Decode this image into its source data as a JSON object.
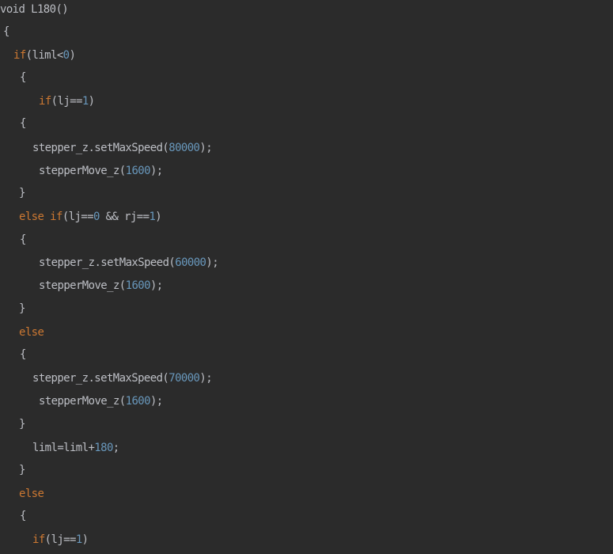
{
  "editor": {
    "colors": {
      "background": "#2b2b2b",
      "plain": "#bcbec4",
      "keyword": "#cc7832",
      "number": "#6897bb"
    },
    "lines": [
      {
        "tokens": [
          {
            "t": "void L180()",
            "c": "pl"
          }
        ]
      },
      {
        "tokens": [
          {
            "t": "{",
            "c": "pl"
          }
        ]
      },
      {
        "tokens": [
          {
            "t": "if",
            "c": "kw"
          },
          {
            "t": "(liml<",
            "c": "pl"
          },
          {
            "t": "0",
            "c": "num"
          },
          {
            "t": ")",
            "c": "pl"
          }
        ]
      },
      {
        "tokens": [
          {
            "t": "{",
            "c": "pl"
          }
        ]
      },
      {
        "tokens": [
          {
            "t": "if",
            "c": "kw"
          },
          {
            "t": "(lj==",
            "c": "pl"
          },
          {
            "t": "1",
            "c": "num"
          },
          {
            "t": ")",
            "c": "pl"
          }
        ]
      },
      {
        "tokens": [
          {
            "t": "{",
            "c": "pl"
          }
        ]
      },
      {
        "tokens": [
          {
            "t": "stepper_z.setMaxSpeed(",
            "c": "pl"
          },
          {
            "t": "80000",
            "c": "num"
          },
          {
            "t": ");",
            "c": "pl"
          }
        ]
      },
      {
        "tokens": [
          {
            "t": "stepperMove_z(",
            "c": "pl"
          },
          {
            "t": "1600",
            "c": "num"
          },
          {
            "t": ");",
            "c": "pl"
          }
        ]
      },
      {
        "tokens": [
          {
            "t": "}",
            "c": "pl"
          }
        ]
      },
      {
        "tokens": [
          {
            "t": "else if",
            "c": "kw"
          },
          {
            "t": "(lj==",
            "c": "pl"
          },
          {
            "t": "0",
            "c": "num"
          },
          {
            "t": " && rj==",
            "c": "pl"
          },
          {
            "t": "1",
            "c": "num"
          },
          {
            "t": ")",
            "c": "pl"
          }
        ]
      },
      {
        "tokens": [
          {
            "t": "{",
            "c": "pl"
          }
        ]
      },
      {
        "tokens": [
          {
            "t": "stepper_z.setMaxSpeed(",
            "c": "pl"
          },
          {
            "t": "60000",
            "c": "num"
          },
          {
            "t": ");",
            "c": "pl"
          }
        ]
      },
      {
        "tokens": [
          {
            "t": "stepperMove_z(",
            "c": "pl"
          },
          {
            "t": "1600",
            "c": "num"
          },
          {
            "t": ");",
            "c": "pl"
          }
        ]
      },
      {
        "tokens": [
          {
            "t": "}",
            "c": "pl"
          }
        ]
      },
      {
        "tokens": [
          {
            "t": "else",
            "c": "kw"
          }
        ]
      },
      {
        "tokens": [
          {
            "t": "{",
            "c": "pl"
          }
        ]
      },
      {
        "tokens": [
          {
            "t": "stepper_z.setMaxSpeed(",
            "c": "pl"
          },
          {
            "t": "70000",
            "c": "num"
          },
          {
            "t": ");",
            "c": "pl"
          }
        ]
      },
      {
        "tokens": [
          {
            "t": "stepperMove_z(",
            "c": "pl"
          },
          {
            "t": "1600",
            "c": "num"
          },
          {
            "t": ");",
            "c": "pl"
          }
        ]
      },
      {
        "tokens": [
          {
            "t": "}",
            "c": "pl"
          }
        ]
      },
      {
        "tokens": [
          {
            "t": "liml=liml+",
            "c": "pl"
          },
          {
            "t": "180",
            "c": "num"
          },
          {
            "t": ";",
            "c": "pl"
          }
        ]
      },
      {
        "tokens": [
          {
            "t": "}",
            "c": "pl"
          }
        ]
      },
      {
        "tokens": [
          {
            "t": "else",
            "c": "kw"
          }
        ]
      },
      {
        "tokens": [
          {
            "t": "{",
            "c": "pl"
          }
        ]
      },
      {
        "tokens": [
          {
            "t": "if",
            "c": "kw"
          },
          {
            "t": "(lj==",
            "c": "pl"
          },
          {
            "t": "1",
            "c": "num"
          },
          {
            "t": ")",
            "c": "pl"
          }
        ]
      }
    ]
  }
}
